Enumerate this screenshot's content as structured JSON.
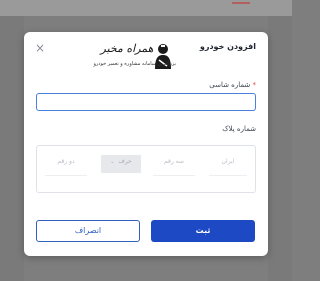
{
  "modal": {
    "title": "افزودن خودرو",
    "close_icon": "×"
  },
  "logo": {
    "brand": "همراه مخبر",
    "tagline": "بزرگترین سامانه مشاوره و تعمیر خودرو"
  },
  "form": {
    "chassis": {
      "required_mark": "*",
      "label": "شماره شاسی",
      "value": ""
    },
    "plate": {
      "label": "شماره پلاک",
      "fields": {
        "iran": "ایران",
        "three_digit": "سه رقم",
        "letter": "حرف",
        "two_digit": "دو رقم"
      }
    }
  },
  "actions": {
    "submit_label": "ثبت",
    "cancel_label": "انصراف"
  },
  "colors": {
    "primary": "#1d49c4",
    "required": "#e0413f",
    "focus_border": "#4a80e0"
  }
}
